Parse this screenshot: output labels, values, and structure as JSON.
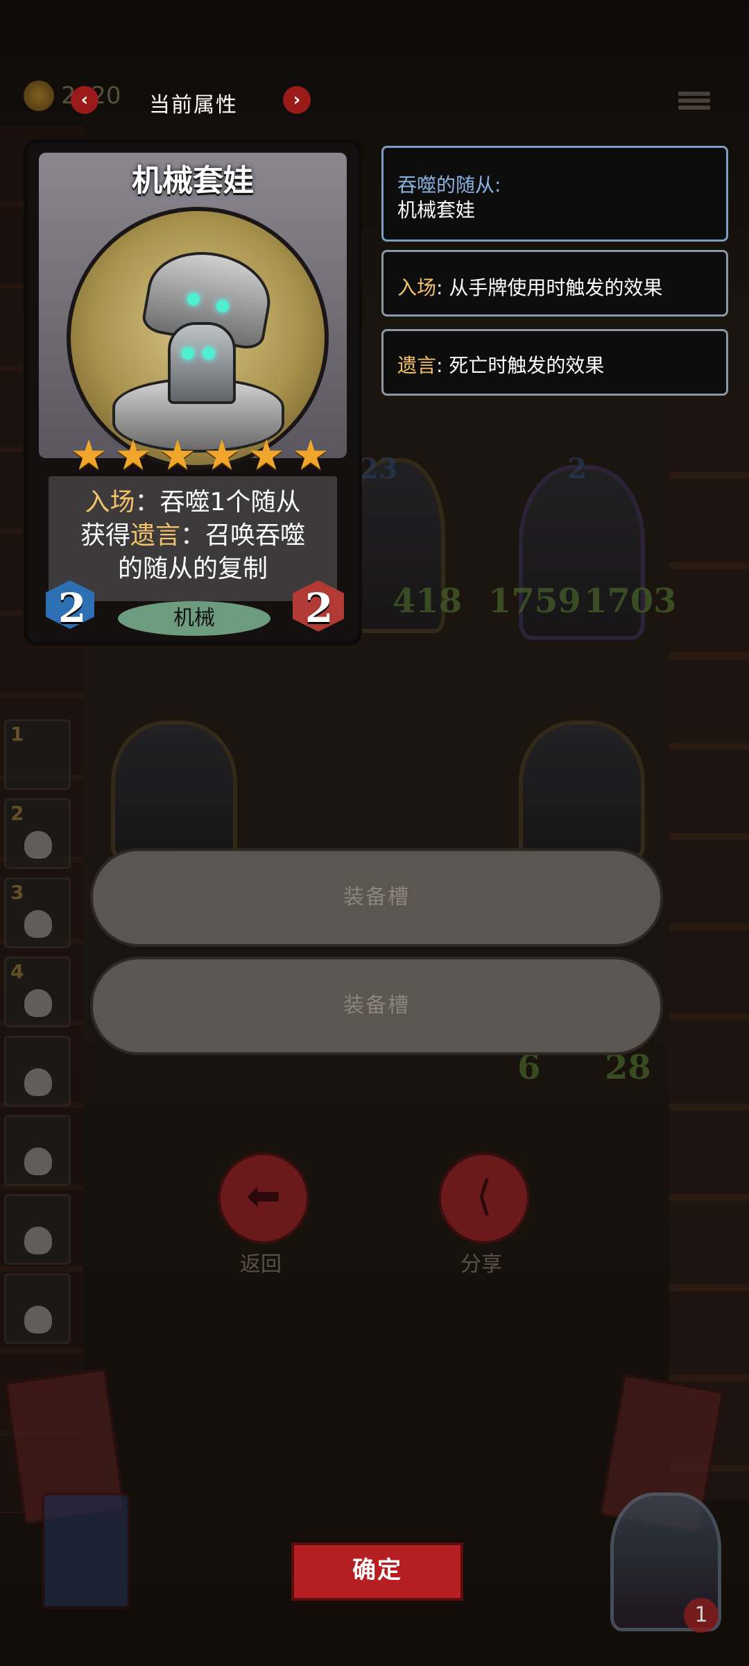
{
  "header": {
    "gold_value": "2020",
    "title": "当前属性",
    "prev_label": "‹",
    "next_label": "›"
  },
  "card": {
    "name": "机械套娃",
    "star_count": 6,
    "desc_line1_kw": "入场",
    "desc_line1_rest": "：吞噬1个随从",
    "desc_line2_pre": "获得",
    "desc_line2_kw": "遗言",
    "desc_line2_rest": "：召唤吞噬",
    "desc_line3": "的随从的复制",
    "cost": "2",
    "attack": "2",
    "tribe": "机械"
  },
  "info": {
    "devoured_label": "吞噬的随从:",
    "devoured_value": "机械套娃",
    "battlecry_kw": "入场",
    "battlecry_text": ": 从手牌使用时触发的效果",
    "deathrattle_kw": "遗言",
    "deathrattle_text": ": 死亡时触发的效果"
  },
  "board": {
    "minion1_stats": "418",
    "minion1_badge": "23",
    "minion2_attack": "1759",
    "minion2_health": "1703",
    "minion2_badge": "2",
    "minion3_attack": "6",
    "minion3_health": "28"
  },
  "sidebar_slots": [
    "1",
    "2",
    "3",
    "4",
    "",
    "",
    "",
    ""
  ],
  "equip_slots": [
    "装备槽",
    "装备槽"
  ],
  "actions": {
    "back_label": "返回",
    "share_label": "分享"
  },
  "footer": {
    "confirm_label": "确定",
    "hero_hp": "1"
  },
  "colors": {
    "accent_red": "#b51f22",
    "keyword_gold": "#f3c26a",
    "stat_green": "#69923f",
    "info_blue": "#8ab2e2"
  }
}
